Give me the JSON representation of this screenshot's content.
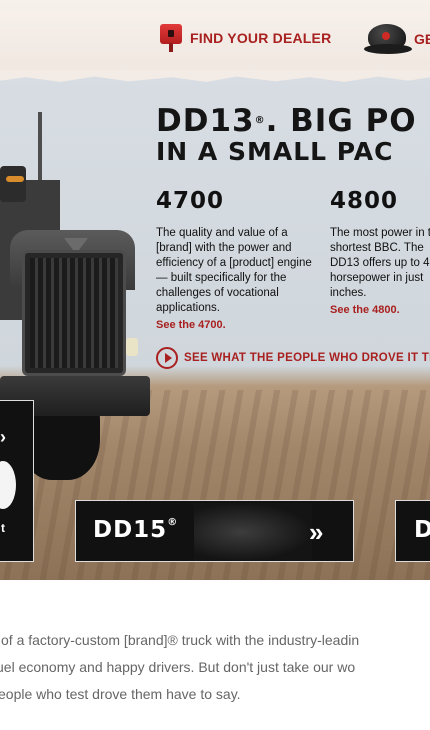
{
  "header": {
    "find_dealer": "FIND YOUR DEALER",
    "get_label": "GE"
  },
  "hero": {
    "headline_line1": "DD13",
    "headline_reg": "®",
    "headline_line1_rest": ". BIG PO",
    "headline_line2": "IN A SMALL PAC",
    "columns": [
      {
        "model": "4700",
        "description": "The quality and value of a [brand] with the power and efficiency of a [product] engine — built specifically for the challenges of vocational applications.",
        "link": "See the 4700."
      },
      {
        "model": "4800",
        "description": "The most power in the shortest BBC. The DD13 offers up to 4 horsepower in just inches.",
        "link": "See the 4800."
      }
    ],
    "video_link": "SEE WHAT THE PEOPLE WHO DROVE IT THO"
  },
  "tiles": {
    "left_text": "t",
    "dd15_label": "DD15",
    "dd15_reg": "®",
    "chevrons": "»",
    "right_text": "D"
  },
  "copy": {
    "line1": "of a factory-custom [brand]® truck with the industry-leadin",
    "line2": "uel economy and happy drivers. But don't just take our wo",
    "line3": "eople who test drove them have to say."
  }
}
